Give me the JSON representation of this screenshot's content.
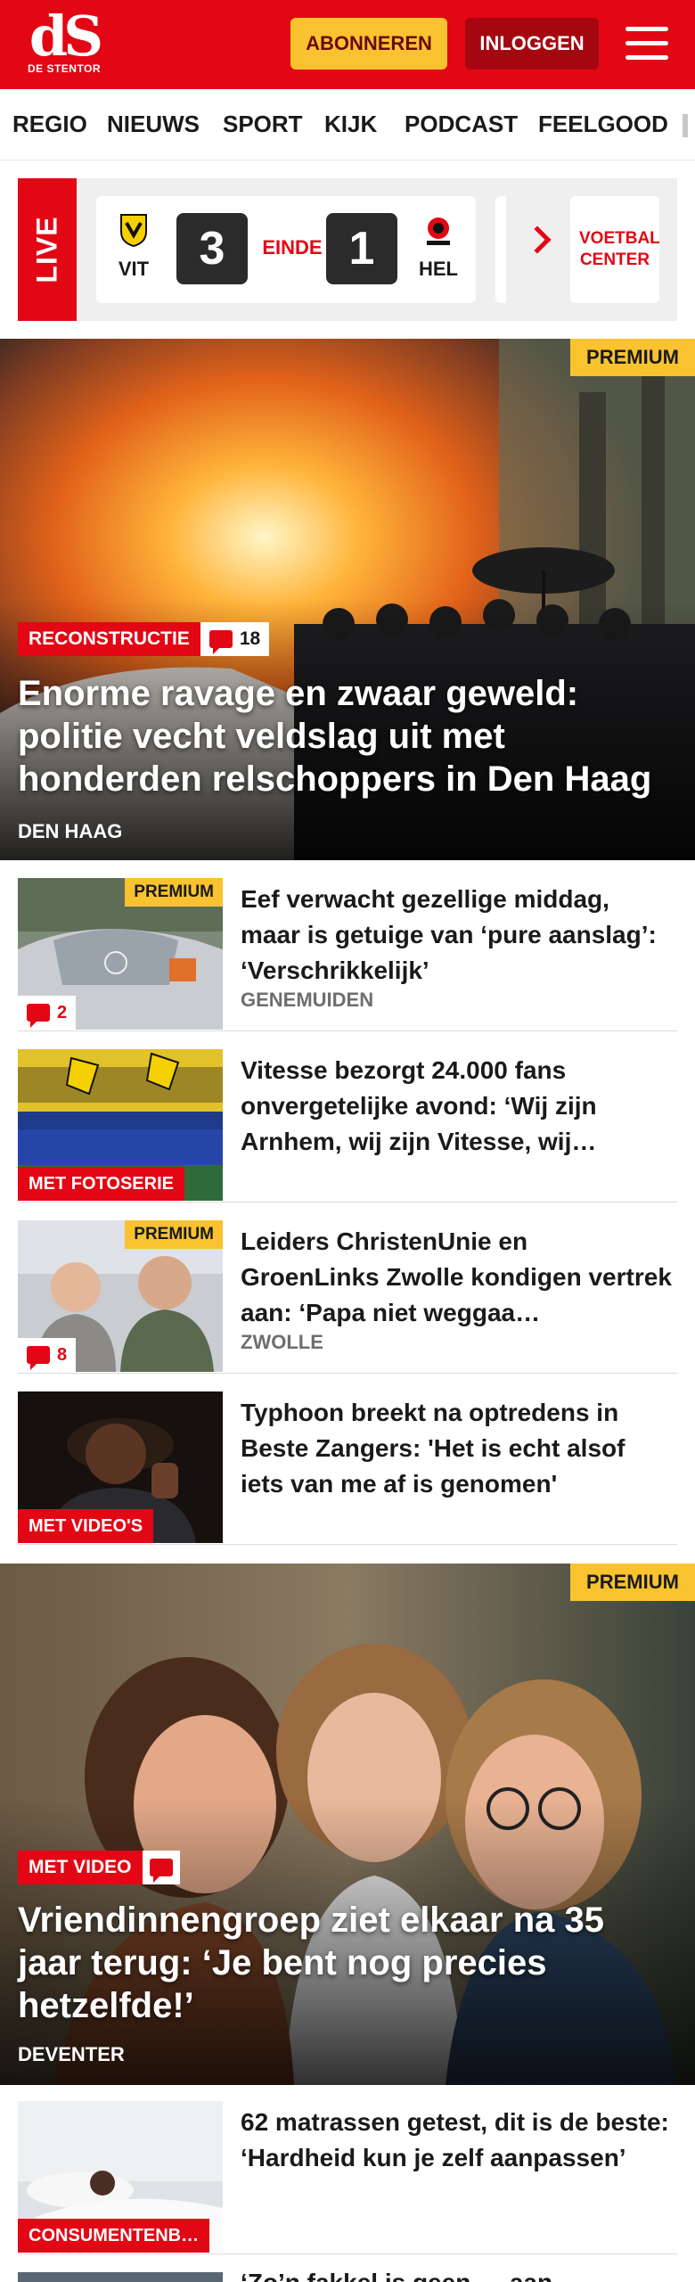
{
  "header": {
    "logo_mark": "dS",
    "logo_sub": "DE STENTOR",
    "subscribe_label": "ABONNEREN",
    "login_label": "INLOGGEN",
    "menu_icon": "hamburger-icon",
    "brand_color": "#e30614",
    "accent_color": "#f9c32f"
  },
  "nav": {
    "items": [
      "REGIO",
      "NIEUWS",
      "SPORT",
      "KIJK",
      "PODCAST",
      "FEELGOOD"
    ]
  },
  "live": {
    "label": "LIVE",
    "home_team": "VIT",
    "home_score": "3",
    "status": "EINDE",
    "away_score": "1",
    "away_team": "HEL",
    "next_icon": "chevron-right-icon",
    "center_label": "VOETBAL CENTER"
  },
  "hero1": {
    "premium": "PREMIUM",
    "tag": "RECONSTRUCTIE",
    "comments": "18",
    "title": "Enorme ravage en zwaar geweld: politie vecht veldslag uit met honderden relschoppers in Den Haag",
    "location": "DEN HAAG"
  },
  "articles": [
    {
      "title": "Eef verwacht gezellige middag, maar is getuige van ‘pure aanslag’: ‘Verschrikkelijk’",
      "location": "GENEMUIDEN",
      "premium": "PREMIUM",
      "comments": "2",
      "label": ""
    },
    {
      "title": "Vitesse bezorgt 24.000 fans onvergetelijke avond: ‘Wij zijn Arnhem, wij zijn Vitesse, wij…",
      "location": "",
      "premium": "",
      "comments": "",
      "label": "MET FOTOSERIE"
    },
    {
      "title": "Leiders ChristenUnie en GroenLinks Zwolle kondigen vertrek aan: ‘Papa niet weggaa…",
      "location": "ZWOLLE",
      "premium": "PREMIUM",
      "comments": "8",
      "label": ""
    },
    {
      "title": "Typhoon breekt na optredens in Beste Zangers: 'Het is echt alsof iets van me af is genomen'",
      "location": "",
      "premium": "",
      "comments": "",
      "label": "MET VIDEO'S"
    }
  ],
  "hero2": {
    "premium": "PREMIUM",
    "tag": "MET VIDEO",
    "title": "Vriendinnengroep ziet elkaar na 35 jaar terug: ‘Je bent nog precies hetzelfde!’",
    "location": "DEVENTER"
  },
  "article5": {
    "title": "62 matrassen getest, dit is de beste: ‘Hardheid kun je zelf aanpassen’",
    "label": "CONSUMENTENB…"
  },
  "article6": {
    "title_partial": "‘Zo’n fakkel is geen … aan"
  }
}
